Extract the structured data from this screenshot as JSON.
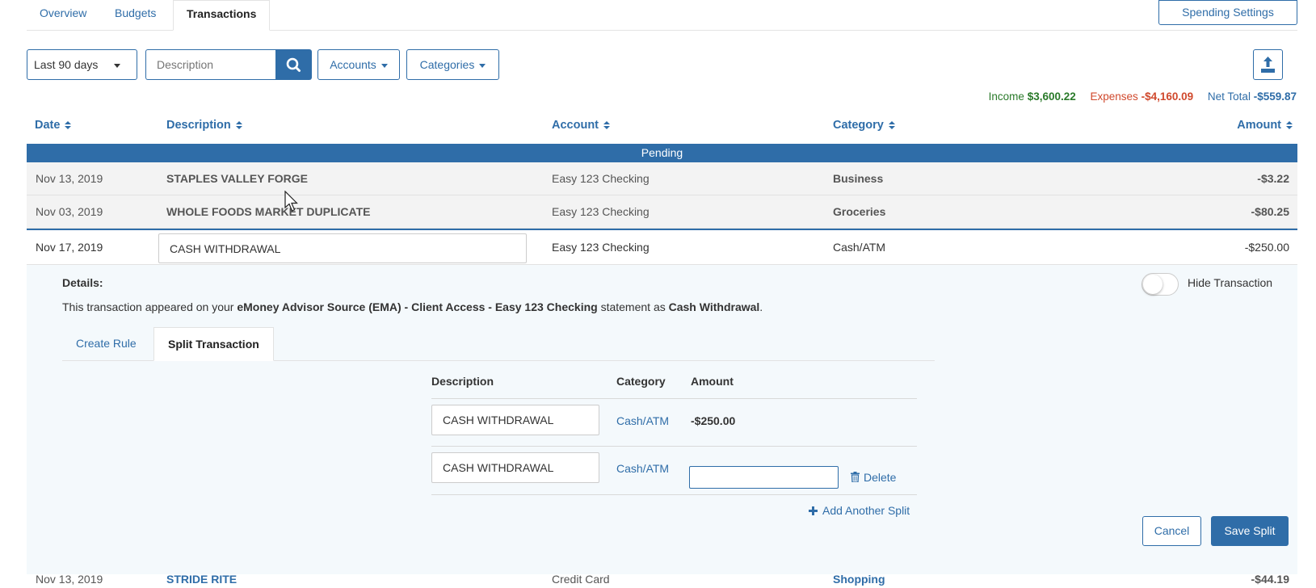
{
  "top_tabs": [
    {
      "label": "Overview"
    },
    {
      "label": "Budgets"
    },
    {
      "label": "Transactions"
    }
  ],
  "spending_settings_label": "Spending Settings",
  "filters": {
    "date_range": "Last 90 days",
    "description_placeholder": "Description",
    "accounts_label": "Accounts",
    "categories_label": "Categories"
  },
  "totals": {
    "income_label": "Income",
    "income_value": "$3,600.22",
    "expenses_label": "Expenses",
    "expenses_value": "-$4,160.09",
    "net_label": "Net Total",
    "net_value": "-$559.87"
  },
  "columns": {
    "date": "Date",
    "description": "Description",
    "account": "Account",
    "category": "Category",
    "amount": "Amount"
  },
  "pending_label": "Pending",
  "pending_rows": [
    {
      "date": "Nov 13, 2019",
      "description": "STAPLES VALLEY FORGE",
      "account": "Easy 123 Checking",
      "category": "Business",
      "amount": "-$3.22"
    },
    {
      "date": "Nov 03, 2019",
      "description": "WHOLE FOODS MARKET DUPLICATE",
      "account": "Easy 123 Checking",
      "category": "Groceries",
      "amount": "-$80.25"
    }
  ],
  "active_row": {
    "date": "Nov 17, 2019",
    "description": "CASH WITHDRAWAL",
    "account": "Easy 123 Checking",
    "category": "Cash/ATM",
    "amount": "-$250.00"
  },
  "details": {
    "label": "Details:",
    "text_prefix": "This transaction appeared on your ",
    "source": "eMoney Advisor Source (EMA) - Client Access - Easy 123 Checking",
    "text_mid": " statement as ",
    "statement_name": "Cash Withdrawal",
    "text_suffix": ".",
    "hide_transaction_label": "Hide Transaction"
  },
  "sub_tabs": [
    {
      "label": "Create Rule"
    },
    {
      "label": "Split Transaction"
    }
  ],
  "split": {
    "headers": {
      "description": "Description",
      "category": "Category",
      "amount": "Amount"
    },
    "rows": [
      {
        "description": "CASH WITHDRAWAL",
        "category": "Cash/ATM",
        "amount": "-$250.00"
      },
      {
        "description": "CASH WITHDRAWAL",
        "category": "Cash/ATM",
        "amount": ""
      }
    ],
    "delete_label": "Delete",
    "add_label": "Add Another Split",
    "cancel_label": "Cancel",
    "save_label": "Save Split"
  },
  "next_row": {
    "date": "Nov 13, 2019",
    "description": "STRIDE RITE",
    "account": "Credit Card",
    "category": "Shopping",
    "amount": "-$44.19"
  },
  "colors": {
    "accent": "#2f6da8",
    "income": "#2a7a2a",
    "expense": "#d0492d",
    "details_bg": "#f4f9fc"
  },
  "icons": [
    "search-icon",
    "upload-icon",
    "sort-icon",
    "caret-down-icon",
    "trash-icon",
    "plus-icon"
  ]
}
